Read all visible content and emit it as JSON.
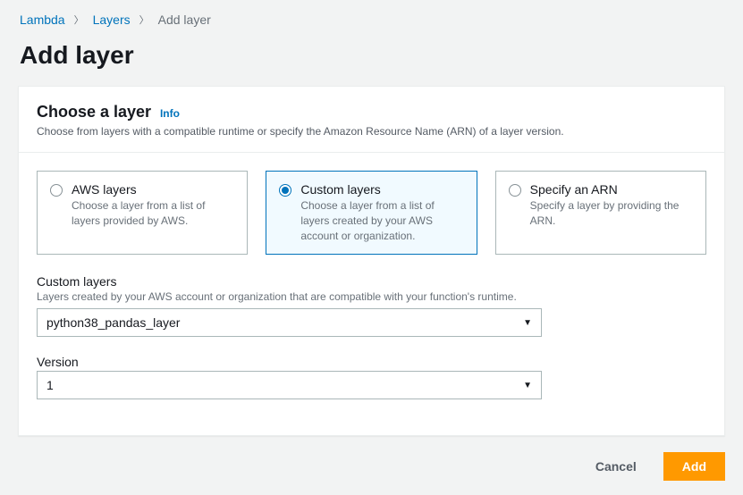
{
  "breadcrumb": {
    "item1": "Lambda",
    "item2": "Layers",
    "current": "Add layer"
  },
  "page_title": "Add layer",
  "panel": {
    "title": "Choose a layer",
    "info": "Info",
    "desc": "Choose from layers with a compatible runtime or specify the Amazon Resource Name (ARN) of a layer version."
  },
  "options": {
    "aws": {
      "title": "AWS layers",
      "sub": "Choose a layer from a list of layers provided by AWS."
    },
    "custom": {
      "title": "Custom layers",
      "sub": "Choose a layer from a list of layers created by your AWS account or organization."
    },
    "arn": {
      "title": "Specify an ARN",
      "sub": "Specify a layer by providing the ARN."
    }
  },
  "custom_layers": {
    "label": "Custom layers",
    "desc": "Layers created by your AWS account or organization that are compatible with your function's runtime.",
    "value": "python38_pandas_layer"
  },
  "version": {
    "label": "Version",
    "value": "1"
  },
  "buttons": {
    "cancel": "Cancel",
    "add": "Add"
  }
}
